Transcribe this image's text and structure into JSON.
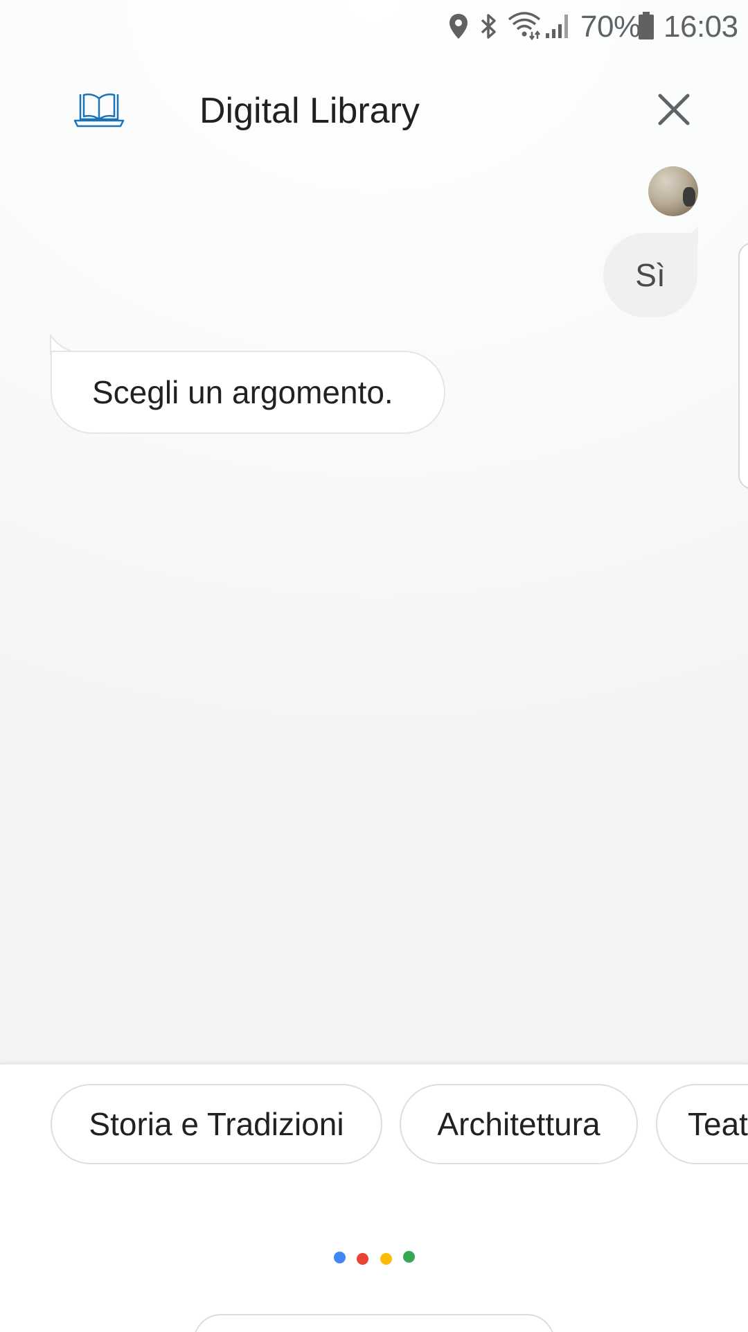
{
  "status_bar": {
    "battery_percent": "70%",
    "time": "16:03",
    "icons": [
      "location-icon",
      "bluetooth-icon",
      "wifi-icon",
      "signal-icon",
      "battery-icon"
    ]
  },
  "header": {
    "title": "Digital Library",
    "logo_icon": "book-laptop-icon",
    "close_icon": "close-icon",
    "logo_color": "#1a73b8"
  },
  "conversation": {
    "user_message": "Sì",
    "assistant_message": "Scegli un argomento."
  },
  "suggestions": {
    "chips": [
      {
        "label": "Storia e Tradizioni"
      },
      {
        "label": "Architettura"
      },
      {
        "label": "Teatro"
      }
    ]
  },
  "assistant_dots": {
    "colors": [
      "#4285f4",
      "#ea4335",
      "#fbbc05",
      "#34a853"
    ]
  }
}
